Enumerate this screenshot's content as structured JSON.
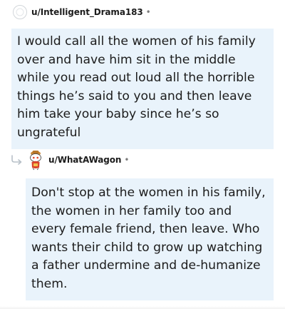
{
  "comments": [
    {
      "username": "u/Intelligent_Drama183",
      "separator": "•",
      "avatar_icon": "blank-avatar-icon",
      "body": "I would call all the women of his family over and have him sit in the middle while you read out loud all the horrible things he’s said to you and then leave him take your baby since he’s so ungrateful"
    },
    {
      "username": "u/WhatAWagon",
      "separator": "•",
      "avatar_icon": "snoo-avatar-icon",
      "reply_icon": "reply-arrow-icon",
      "body": "Don't stop at the women in his family, the women in her family too and every female friend, then leave. Who wants their child to grow up watching a father undermine and de-humanize them."
    }
  ],
  "colors": {
    "bubble": "#e9f3fb",
    "text": "#1c1c1c",
    "meta": "#7c7c7c"
  }
}
